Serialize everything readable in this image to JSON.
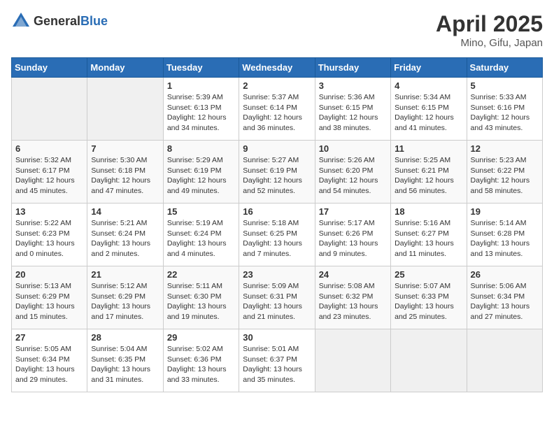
{
  "header": {
    "logo_general": "General",
    "logo_blue": "Blue",
    "month_year": "April 2025",
    "location": "Mino, Gifu, Japan"
  },
  "days_of_week": [
    "Sunday",
    "Monday",
    "Tuesday",
    "Wednesday",
    "Thursday",
    "Friday",
    "Saturday"
  ],
  "weeks": [
    [
      {
        "day": "",
        "content": ""
      },
      {
        "day": "",
        "content": ""
      },
      {
        "day": "1",
        "content": "Sunrise: 5:39 AM\nSunset: 6:13 PM\nDaylight: 12 hours\nand 34 minutes."
      },
      {
        "day": "2",
        "content": "Sunrise: 5:37 AM\nSunset: 6:14 PM\nDaylight: 12 hours\nand 36 minutes."
      },
      {
        "day": "3",
        "content": "Sunrise: 5:36 AM\nSunset: 6:15 PM\nDaylight: 12 hours\nand 38 minutes."
      },
      {
        "day": "4",
        "content": "Sunrise: 5:34 AM\nSunset: 6:15 PM\nDaylight: 12 hours\nand 41 minutes."
      },
      {
        "day": "5",
        "content": "Sunrise: 5:33 AM\nSunset: 6:16 PM\nDaylight: 12 hours\nand 43 minutes."
      }
    ],
    [
      {
        "day": "6",
        "content": "Sunrise: 5:32 AM\nSunset: 6:17 PM\nDaylight: 12 hours\nand 45 minutes."
      },
      {
        "day": "7",
        "content": "Sunrise: 5:30 AM\nSunset: 6:18 PM\nDaylight: 12 hours\nand 47 minutes."
      },
      {
        "day": "8",
        "content": "Sunrise: 5:29 AM\nSunset: 6:19 PM\nDaylight: 12 hours\nand 49 minutes."
      },
      {
        "day": "9",
        "content": "Sunrise: 5:27 AM\nSunset: 6:19 PM\nDaylight: 12 hours\nand 52 minutes."
      },
      {
        "day": "10",
        "content": "Sunrise: 5:26 AM\nSunset: 6:20 PM\nDaylight: 12 hours\nand 54 minutes."
      },
      {
        "day": "11",
        "content": "Sunrise: 5:25 AM\nSunset: 6:21 PM\nDaylight: 12 hours\nand 56 minutes."
      },
      {
        "day": "12",
        "content": "Sunrise: 5:23 AM\nSunset: 6:22 PM\nDaylight: 12 hours\nand 58 minutes."
      }
    ],
    [
      {
        "day": "13",
        "content": "Sunrise: 5:22 AM\nSunset: 6:23 PM\nDaylight: 13 hours\nand 0 minutes."
      },
      {
        "day": "14",
        "content": "Sunrise: 5:21 AM\nSunset: 6:24 PM\nDaylight: 13 hours\nand 2 minutes."
      },
      {
        "day": "15",
        "content": "Sunrise: 5:19 AM\nSunset: 6:24 PM\nDaylight: 13 hours\nand 4 minutes."
      },
      {
        "day": "16",
        "content": "Sunrise: 5:18 AM\nSunset: 6:25 PM\nDaylight: 13 hours\nand 7 minutes."
      },
      {
        "day": "17",
        "content": "Sunrise: 5:17 AM\nSunset: 6:26 PM\nDaylight: 13 hours\nand 9 minutes."
      },
      {
        "day": "18",
        "content": "Sunrise: 5:16 AM\nSunset: 6:27 PM\nDaylight: 13 hours\nand 11 minutes."
      },
      {
        "day": "19",
        "content": "Sunrise: 5:14 AM\nSunset: 6:28 PM\nDaylight: 13 hours\nand 13 minutes."
      }
    ],
    [
      {
        "day": "20",
        "content": "Sunrise: 5:13 AM\nSunset: 6:29 PM\nDaylight: 13 hours\nand 15 minutes."
      },
      {
        "day": "21",
        "content": "Sunrise: 5:12 AM\nSunset: 6:29 PM\nDaylight: 13 hours\nand 17 minutes."
      },
      {
        "day": "22",
        "content": "Sunrise: 5:11 AM\nSunset: 6:30 PM\nDaylight: 13 hours\nand 19 minutes."
      },
      {
        "day": "23",
        "content": "Sunrise: 5:09 AM\nSunset: 6:31 PM\nDaylight: 13 hours\nand 21 minutes."
      },
      {
        "day": "24",
        "content": "Sunrise: 5:08 AM\nSunset: 6:32 PM\nDaylight: 13 hours\nand 23 minutes."
      },
      {
        "day": "25",
        "content": "Sunrise: 5:07 AM\nSunset: 6:33 PM\nDaylight: 13 hours\nand 25 minutes."
      },
      {
        "day": "26",
        "content": "Sunrise: 5:06 AM\nSunset: 6:34 PM\nDaylight: 13 hours\nand 27 minutes."
      }
    ],
    [
      {
        "day": "27",
        "content": "Sunrise: 5:05 AM\nSunset: 6:34 PM\nDaylight: 13 hours\nand 29 minutes."
      },
      {
        "day": "28",
        "content": "Sunrise: 5:04 AM\nSunset: 6:35 PM\nDaylight: 13 hours\nand 31 minutes."
      },
      {
        "day": "29",
        "content": "Sunrise: 5:02 AM\nSunset: 6:36 PM\nDaylight: 13 hours\nand 33 minutes."
      },
      {
        "day": "30",
        "content": "Sunrise: 5:01 AM\nSunset: 6:37 PM\nDaylight: 13 hours\nand 35 minutes."
      },
      {
        "day": "",
        "content": ""
      },
      {
        "day": "",
        "content": ""
      },
      {
        "day": "",
        "content": ""
      }
    ]
  ]
}
